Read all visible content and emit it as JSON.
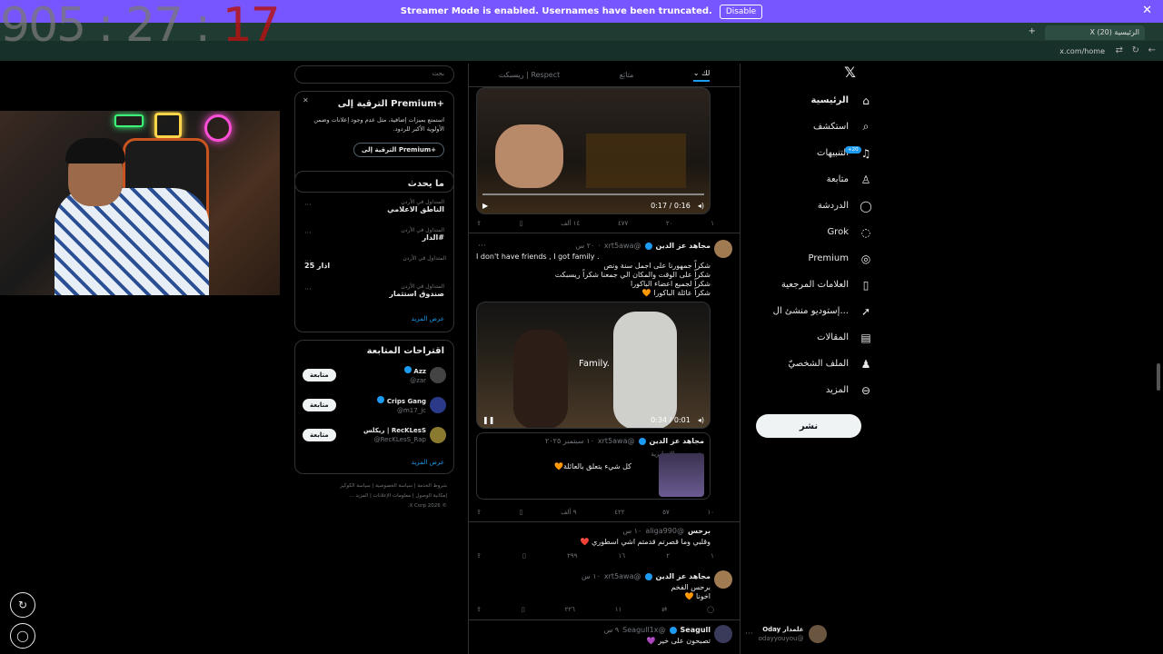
{
  "banner": {
    "text": "Streamer Mode is enabled. Usernames have been truncated.",
    "disable": "Disable",
    "close": "✕"
  },
  "browser": {
    "tab_title": "الرئيسية X (20)",
    "url": "x.com/home"
  },
  "overlay": {
    "timer_main": "905 : 27 : ",
    "timer_red": "17"
  },
  "nav": {
    "items": [
      {
        "label": "الرئيسية",
        "icon": "home-icon",
        "glyph": "⌂"
      },
      {
        "label": "استكشف",
        "icon": "search-icon",
        "glyph": "⌕"
      },
      {
        "label": "التنبيهات",
        "icon": "bell-icon",
        "glyph": "♫"
      },
      {
        "label": "متابعة",
        "icon": "follow-icon",
        "glyph": "♙"
      },
      {
        "label": "الدردشة",
        "icon": "chat-icon",
        "glyph": "◯"
      },
      {
        "label": "Grok",
        "icon": "grok-icon",
        "glyph": "◌"
      },
      {
        "label": "Premium",
        "icon": "premium-icon",
        "glyph": "◎"
      },
      {
        "label": "العلامات المرجعية",
        "icon": "bookmark-icon",
        "glyph": "▯"
      },
      {
        "label": "إستوديو منشئ ال...",
        "icon": "rocket-icon",
        "glyph": "➚"
      },
      {
        "label": "المقالات",
        "icon": "article-icon",
        "glyph": "▤"
      },
      {
        "label": "الملف الشخصيّ",
        "icon": "profile-icon",
        "glyph": "♟"
      },
      {
        "label": "المزيد",
        "icon": "more-icon",
        "glyph": "⊖"
      }
    ],
    "notif_badge": "+20",
    "post": "نشر",
    "account": {
      "name": "علمدار Oday",
      "handle": "@odayyouyou"
    }
  },
  "feed": {
    "tabs": {
      "for_you": "لك",
      "following": "متابَع",
      "respect": "Respect | ريسبكت"
    },
    "video1": {
      "time": "0:17 / 0:16"
    },
    "post1_actions": {
      "views": "١",
      "retweets": "٢٠",
      "likes": "٤٧٧",
      "views2": "١٤ ألف"
    },
    "post2": {
      "name": "مجاهد عز الدين",
      "handle": "@xrt5awa",
      "time": "٢٠ س",
      "lines": [
        "I don't have friends , I got family .",
        "شكراً جمهورنا على اجمل سنة ونص",
        "شكراً على الوقت والمكان الي جمعنا شكراً ريسبكت",
        "شكراً لجميع اعضاء الباكورا",
        "شكراً عائلة الباكورا 🧡"
      ],
      "video_caption": "Family.",
      "video_time": "0:34 / 0:01",
      "quote": {
        "name": "مجاهد عز الدين",
        "handle": "@xrt5awa",
        "date": "١٠ سبتمبر ٢٠٢٥",
        "translated": "مترجم من الإنجليزية",
        "text": "كل شيء يتعلق بالعائلة🧡"
      },
      "actions": {
        "replies": "١٠",
        "retweets": "٥٧",
        "likes": "٤٢٢",
        "views": "٩ ألف"
      }
    },
    "post3": {
      "name": "برحس",
      "handle": "@aliga990",
      "time": "١٠ س",
      "text": "وقلبي وما قصرتم قدمتم اشي اسطوري ❤️",
      "actions": {
        "replies": "١",
        "retweets": "٢",
        "likes": "١٦",
        "views": "٢٩٩"
      }
    },
    "post4": {
      "name": "مجاهد عز الدين",
      "handle": "@xrt5awa",
      "time": "١٠ س",
      "lines": [
        "برحس الفخم",
        "اخونا 🧡"
      ],
      "actions": {
        "likes": "١١",
        "views": "٢٢٦"
      }
    },
    "post5": {
      "name": "Seagull",
      "handle": "@Seagull1x",
      "time": "٩ س",
      "text": "تصبحون على خير 💜"
    }
  },
  "right": {
    "search_placeholder": "بحث",
    "premium": {
      "title": "الترقية إلى Premium+",
      "body": "استمتع بميزات إضافية، مثل عدم وجود إعلانات وضمن الأولوية الأكبر للردود.",
      "button": "الترقية إلى Premium+",
      "close": "✕"
    },
    "trends": {
      "title": "ما يحدث",
      "items": [
        {
          "cat": "المتداول في الأردن",
          "topic": "الناطق الاعلامي"
        },
        {
          "cat": "المتداول في الأردن",
          "topic": "#الدار"
        },
        {
          "cat": "المتداول في الأردن",
          "topic": "اذار 25"
        },
        {
          "cat": "المتداول في الأردن",
          "topic": "صندوق استثمار"
        }
      ],
      "more": "عرض المزيد"
    },
    "who": {
      "title": "اقتراحات المتابعة",
      "items": [
        {
          "name": "Azz",
          "handle": "@zar",
          "btn": "متابعة"
        },
        {
          "name": "Crips Gang",
          "handle": "@m17_jc",
          "btn": "متابعة"
        },
        {
          "name": "ريكلس | RecKLesS",
          "handle": "@RecKLesS_Rap",
          "btn": "متابعة"
        }
      ],
      "more": "عرض المزيد"
    },
    "footer": {
      "l1": "شروط الخدمة | سياسة الخصوصية | سياسة الكوكيز",
      "l2": "إمكانية الوصول | معلومات الإعلانات | المزيد ...",
      "l3": "© 2026 X Corp."
    }
  }
}
